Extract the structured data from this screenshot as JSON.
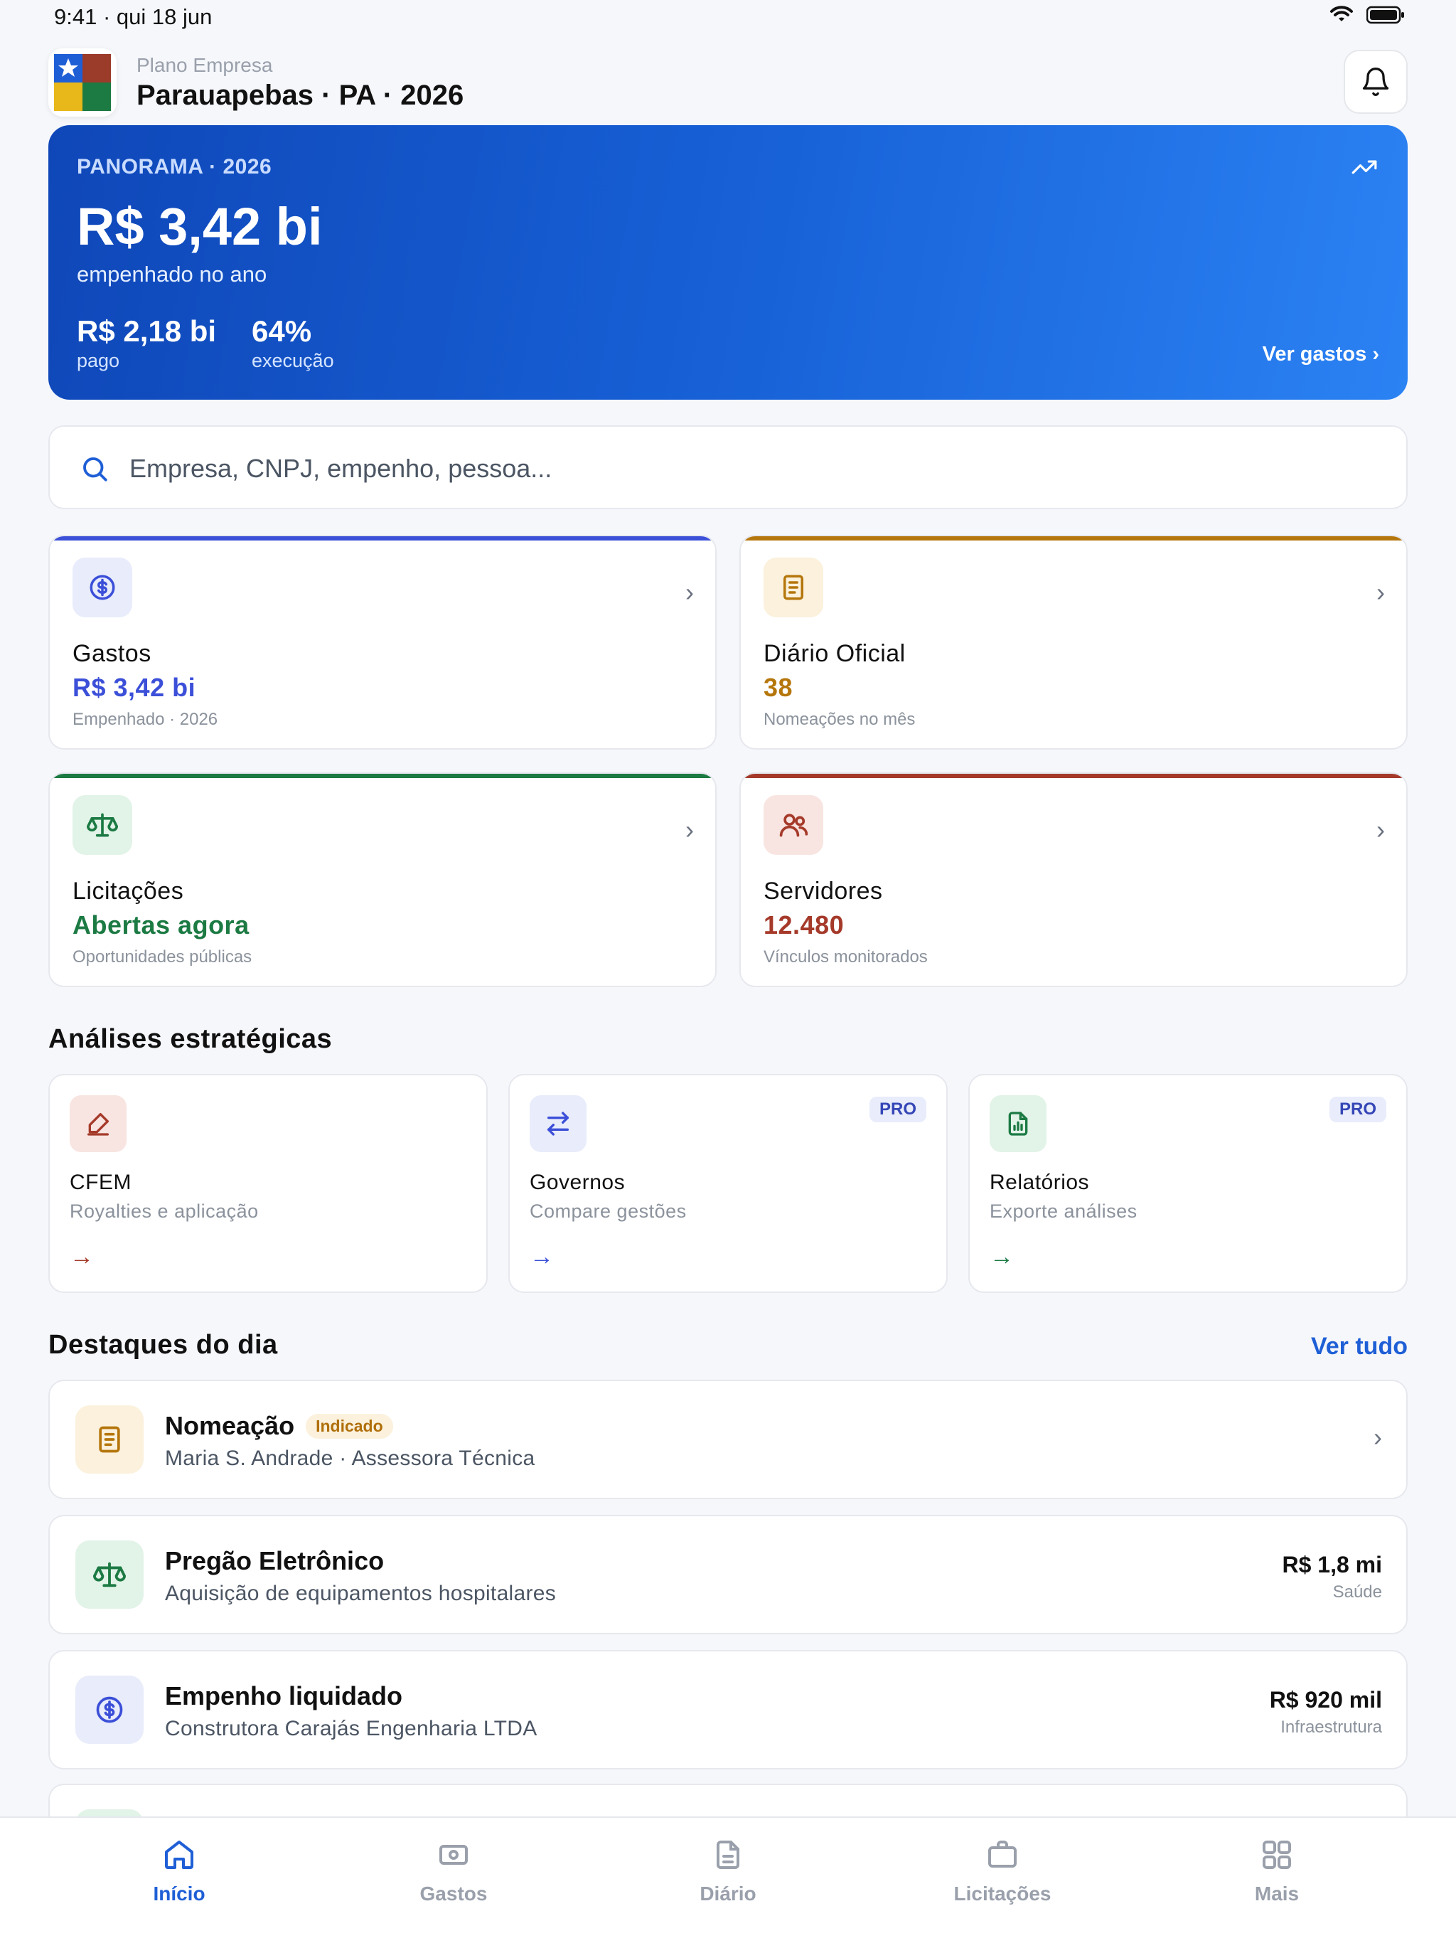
{
  "status_bar": {
    "time": "9:41 · qui 18 jun"
  },
  "header": {
    "subtitle": "Plano Empresa",
    "title": "Parauapebas · PA · 2026"
  },
  "hero": {
    "eyebrow": "PANORAMA · 2026",
    "amount": "R$ 3,42 bi",
    "amount_caption": "empenhado no ano",
    "stats": [
      {
        "value": "R$ 2,18 bi",
        "label": "pago"
      },
      {
        "value": "64%",
        "label": "execução"
      }
    ],
    "link": "Ver gastos ›"
  },
  "search": {
    "placeholder": "Empresa, CNPJ, empenho, pessoa..."
  },
  "cards": [
    {
      "title": "Gastos",
      "value": "R$ 3,42 bi",
      "caption": "Empenhado · 2026",
      "color": "#3b4fd8",
      "icon": "dollar-circle-icon"
    },
    {
      "title": "Diário Oficial",
      "value": "38",
      "caption": "Nomeações no mês",
      "color": "#b5760c",
      "icon": "document-icon"
    },
    {
      "title": "Licitações",
      "value": "Abertas agora",
      "caption": "Oportunidades públicas",
      "color": "#1c7a43",
      "icon": "scale-icon"
    },
    {
      "title": "Servidores",
      "value": "12.480",
      "caption": "Vínculos monitorados",
      "color": "#a53a2a",
      "icon": "users-icon"
    }
  ],
  "analyses": {
    "title": "Análises estratégicas",
    "items": [
      {
        "title": "CFEM",
        "subtitle": "Royalties e aplicação",
        "pro": "",
        "color": "#a53a2a",
        "icon": "pickaxe-icon"
      },
      {
        "title": "Governos",
        "subtitle": "Compare gestões",
        "pro": "PRO",
        "color": "#3b4fd8",
        "icon": "swap-icon"
      },
      {
        "title": "Relatórios",
        "subtitle": "Exporte análises",
        "pro": "PRO",
        "color": "#1c7a43",
        "icon": "report-icon"
      }
    ],
    "arrow": "→"
  },
  "highlights": {
    "title": "Destaques do dia",
    "see_all": "Ver tudo",
    "items": [
      {
        "title": "Nomeação",
        "badge": "Indicado",
        "subtitle": "Maria S. Andrade · Assessora Técnica",
        "value": "",
        "tag": ""
      },
      {
        "title": "Pregão Eletrônico",
        "badge": "",
        "subtitle": "Aquisição de equipamentos hospitalares",
        "value": "R$ 1,8 mi",
        "tag": "Saúde"
      },
      {
        "title": "Empenho liquidado",
        "badge": "",
        "subtitle": "Construtora Carajás Engenharia LTDA",
        "value": "R$ 920 mil",
        "tag": "Infraestrutura"
      }
    ]
  },
  "tabbar": {
    "items": [
      {
        "label": "Início",
        "active": true
      },
      {
        "label": "Gastos",
        "active": false
      },
      {
        "label": "Diário",
        "active": false
      },
      {
        "label": "Licitações",
        "active": false
      },
      {
        "label": "Mais",
        "active": false
      }
    ]
  },
  "colors": {
    "accent": "#1f5fd6",
    "inactive": "#9aa0ab"
  }
}
